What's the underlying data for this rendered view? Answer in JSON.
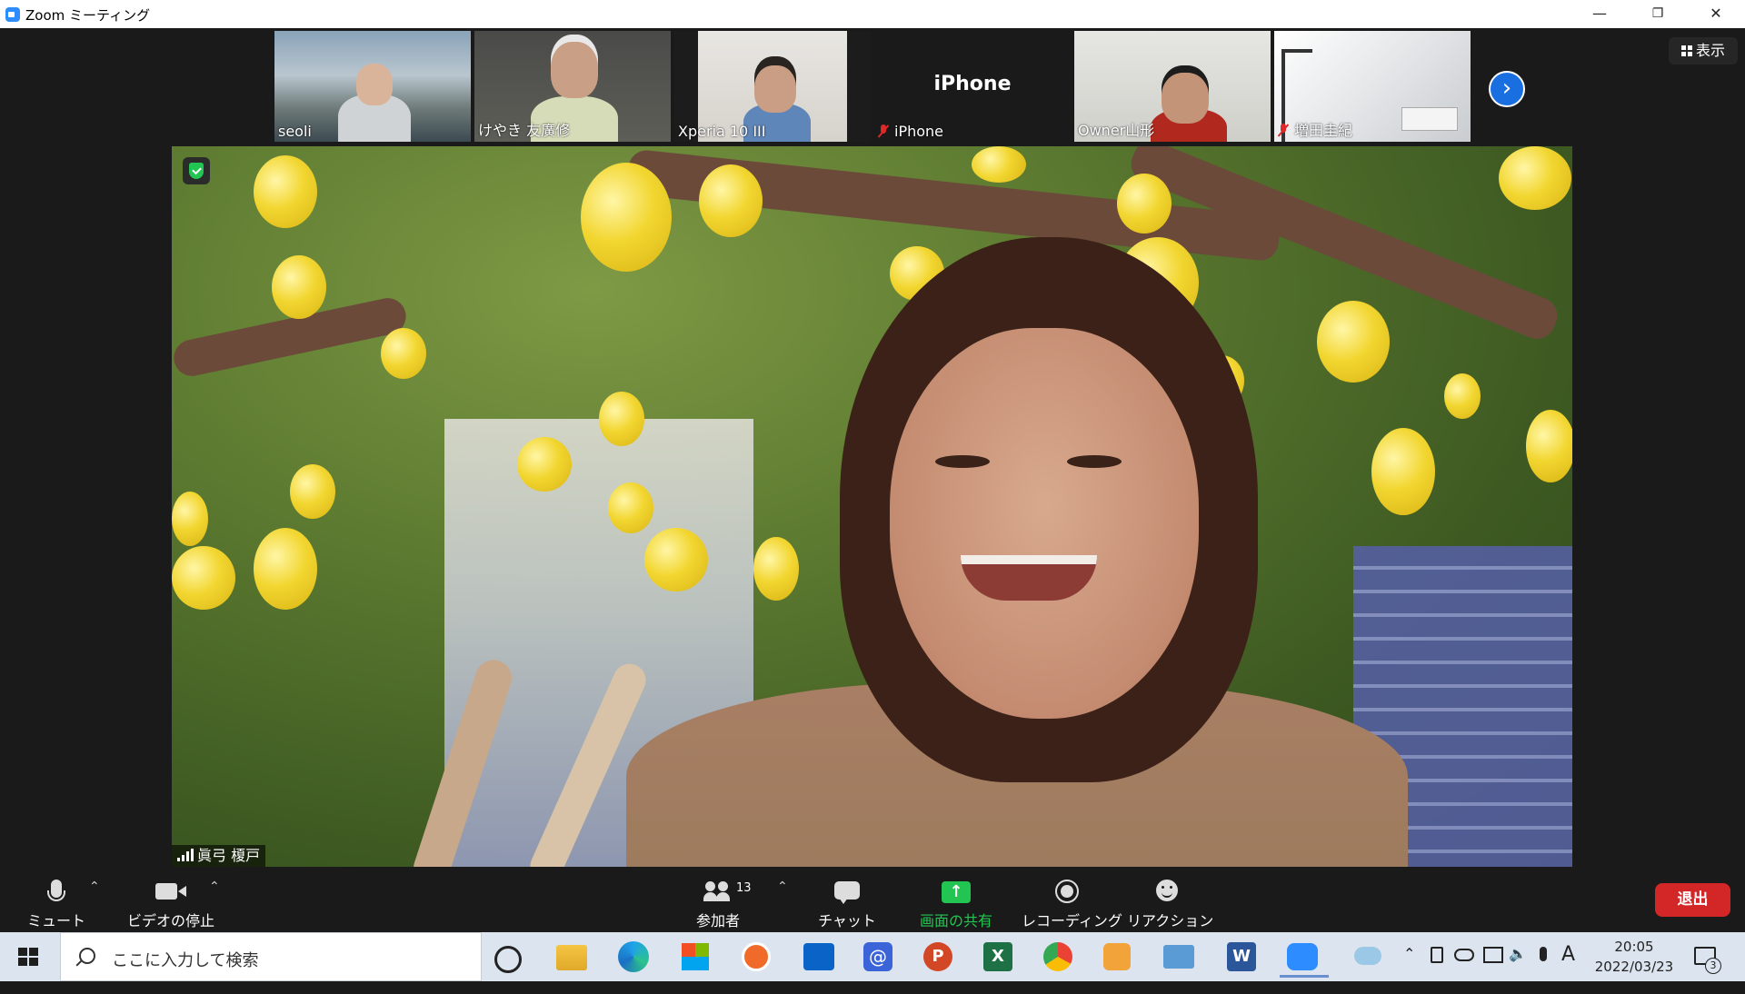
{
  "window": {
    "title": "Zoom ミーティング",
    "minimize": "—",
    "restore": "❐",
    "close": "✕"
  },
  "view_button": {
    "label": "表示"
  },
  "thumbnails": [
    {
      "name": "seoli",
      "muted": false
    },
    {
      "name": "けやき 友廣修",
      "muted": false
    },
    {
      "name": "Xperia 10 III",
      "muted": false
    },
    {
      "name": "iPhone",
      "center_label": "iPhone",
      "muted": true
    },
    {
      "name": "Owner山形",
      "muted": false
    },
    {
      "name": "増田圭紀",
      "muted": true
    }
  ],
  "next_page_icon": "chevron-right-icon",
  "speaker": {
    "name": "眞弓 榎戸"
  },
  "controls": {
    "mute": "ミュート",
    "video": "ビデオの停止",
    "participants": "参加者",
    "participants_count": "13",
    "chat": "チャット",
    "share": "画面の共有",
    "record": "レコーディング",
    "reactions": "リアクション",
    "leave": "退出"
  },
  "taskbar": {
    "search_placeholder": "ここに入力して検索",
    "apps": [
      "task-view-icon",
      "file-explorer-icon",
      "edge-icon",
      "store-icon",
      "app-orange-icon",
      "outlook-icon",
      "mail-icon",
      "powerpoint-icon",
      "excel-icon",
      "chrome-icon",
      "media-player-icon",
      "network-app-icon",
      "word-icon",
      "zoom-icon"
    ],
    "ime": "A",
    "time": "20:05",
    "date": "2022/03/23",
    "notification_count": "3"
  },
  "colors": {
    "accent_blue": "#2d8cff",
    "share_green": "#23c552",
    "leave_red": "#d32626",
    "background": "#1a1a1a"
  }
}
